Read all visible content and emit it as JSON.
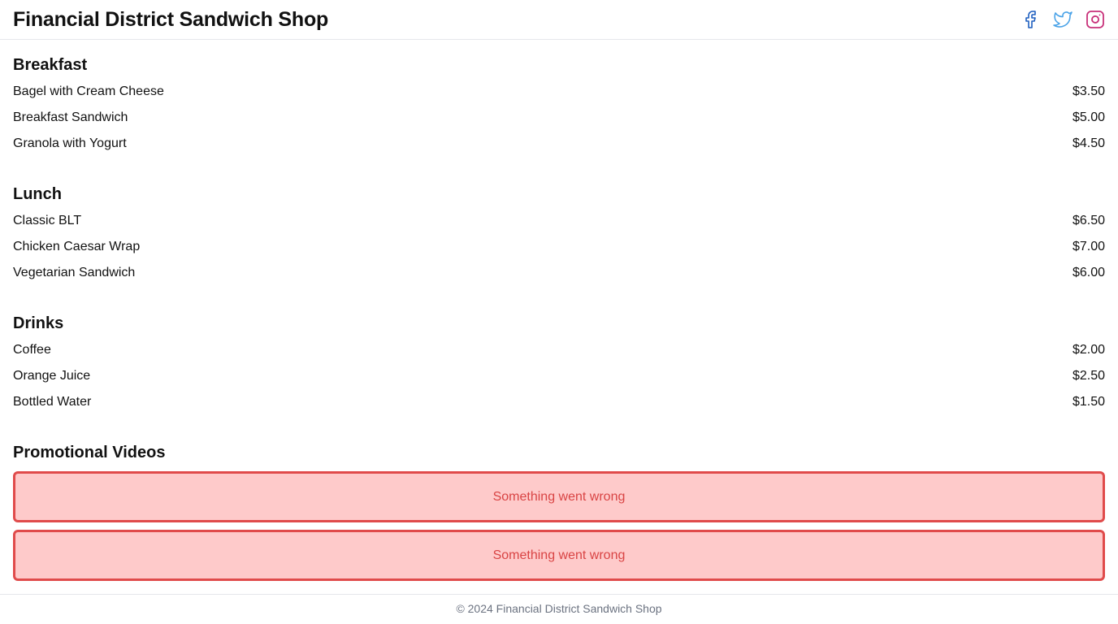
{
  "header": {
    "title": "Financial District Sandwich Shop",
    "social": [
      {
        "name": "facebook",
        "icon": "facebook-icon",
        "color": "#1e5fbf"
      },
      {
        "name": "twitter",
        "icon": "twitter-icon",
        "color": "#4aa3e8"
      },
      {
        "name": "instagram",
        "icon": "instagram-icon",
        "color": "#c8317a"
      }
    ]
  },
  "menu": {
    "breakfast": {
      "title": "Breakfast",
      "items": [
        {
          "name": "Bagel with Cream Cheese",
          "price": "$3.50"
        },
        {
          "name": "Breakfast Sandwich",
          "price": "$5.00"
        },
        {
          "name": "Granola with Yogurt",
          "price": "$4.50"
        }
      ]
    },
    "lunch": {
      "title": "Lunch",
      "items": [
        {
          "name": "Classic BLT",
          "price": "$6.50"
        },
        {
          "name": "Chicken Caesar Wrap",
          "price": "$7.00"
        },
        {
          "name": "Vegetarian Sandwich",
          "price": "$6.00"
        }
      ]
    },
    "drinks": {
      "title": "Drinks",
      "items": [
        {
          "name": "Coffee",
          "price": "$2.00"
        },
        {
          "name": "Orange Juice",
          "price": "$2.50"
        },
        {
          "name": "Bottled Water",
          "price": "$1.50"
        }
      ]
    }
  },
  "videos": {
    "title": "Promotional Videos",
    "errors": [
      {
        "message": "Something went wrong"
      },
      {
        "message": "Something went wrong"
      }
    ],
    "colors": {
      "border": "#e04b4b",
      "background": "#fecaca",
      "text": "#d94444"
    }
  },
  "footer": {
    "text": "© 2024 Financial District Sandwich Shop"
  }
}
